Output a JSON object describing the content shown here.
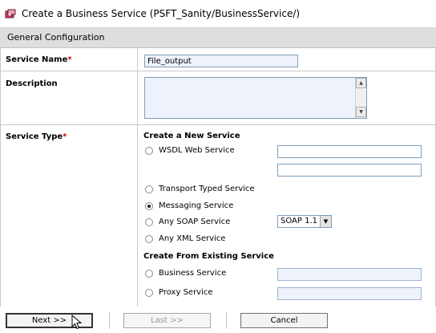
{
  "window": {
    "title": "Create a Business Service (PSFT_Sanity/BusinessService/)"
  },
  "section": {
    "title": "General Configuration"
  },
  "form": {
    "service_name_label": "Service Name",
    "service_name_value": "File_output",
    "description_label": "Description",
    "description_value": "",
    "service_type_label": "Service Type",
    "required_marker": "*"
  },
  "service_type": {
    "create_new_heading": "Create a New Service",
    "options": [
      {
        "label": "WSDL Web Service",
        "selected": false
      },
      {
        "label": "Transport Typed Service",
        "selected": false
      },
      {
        "label": "Messaging Service",
        "selected": true
      },
      {
        "label": "Any SOAP Service",
        "selected": false
      },
      {
        "label": "Any XML Service",
        "selected": false
      }
    ],
    "soap_version": "SOAP 1.1",
    "from_existing_heading": "Create From Existing Service",
    "existing_options": [
      {
        "label": "Business Service",
        "selected": false
      },
      {
        "label": "Proxy Service",
        "selected": false
      }
    ]
  },
  "buttons": {
    "next": "Next >>",
    "last": "Last >>",
    "cancel": "Cancel"
  },
  "colors": {
    "required": "#cc0000",
    "section_bg": "#dedede",
    "input_border": "#7f9db9"
  },
  "icons": {
    "title": "business-service-icon",
    "pointer": "mouse-pointer-icon"
  }
}
